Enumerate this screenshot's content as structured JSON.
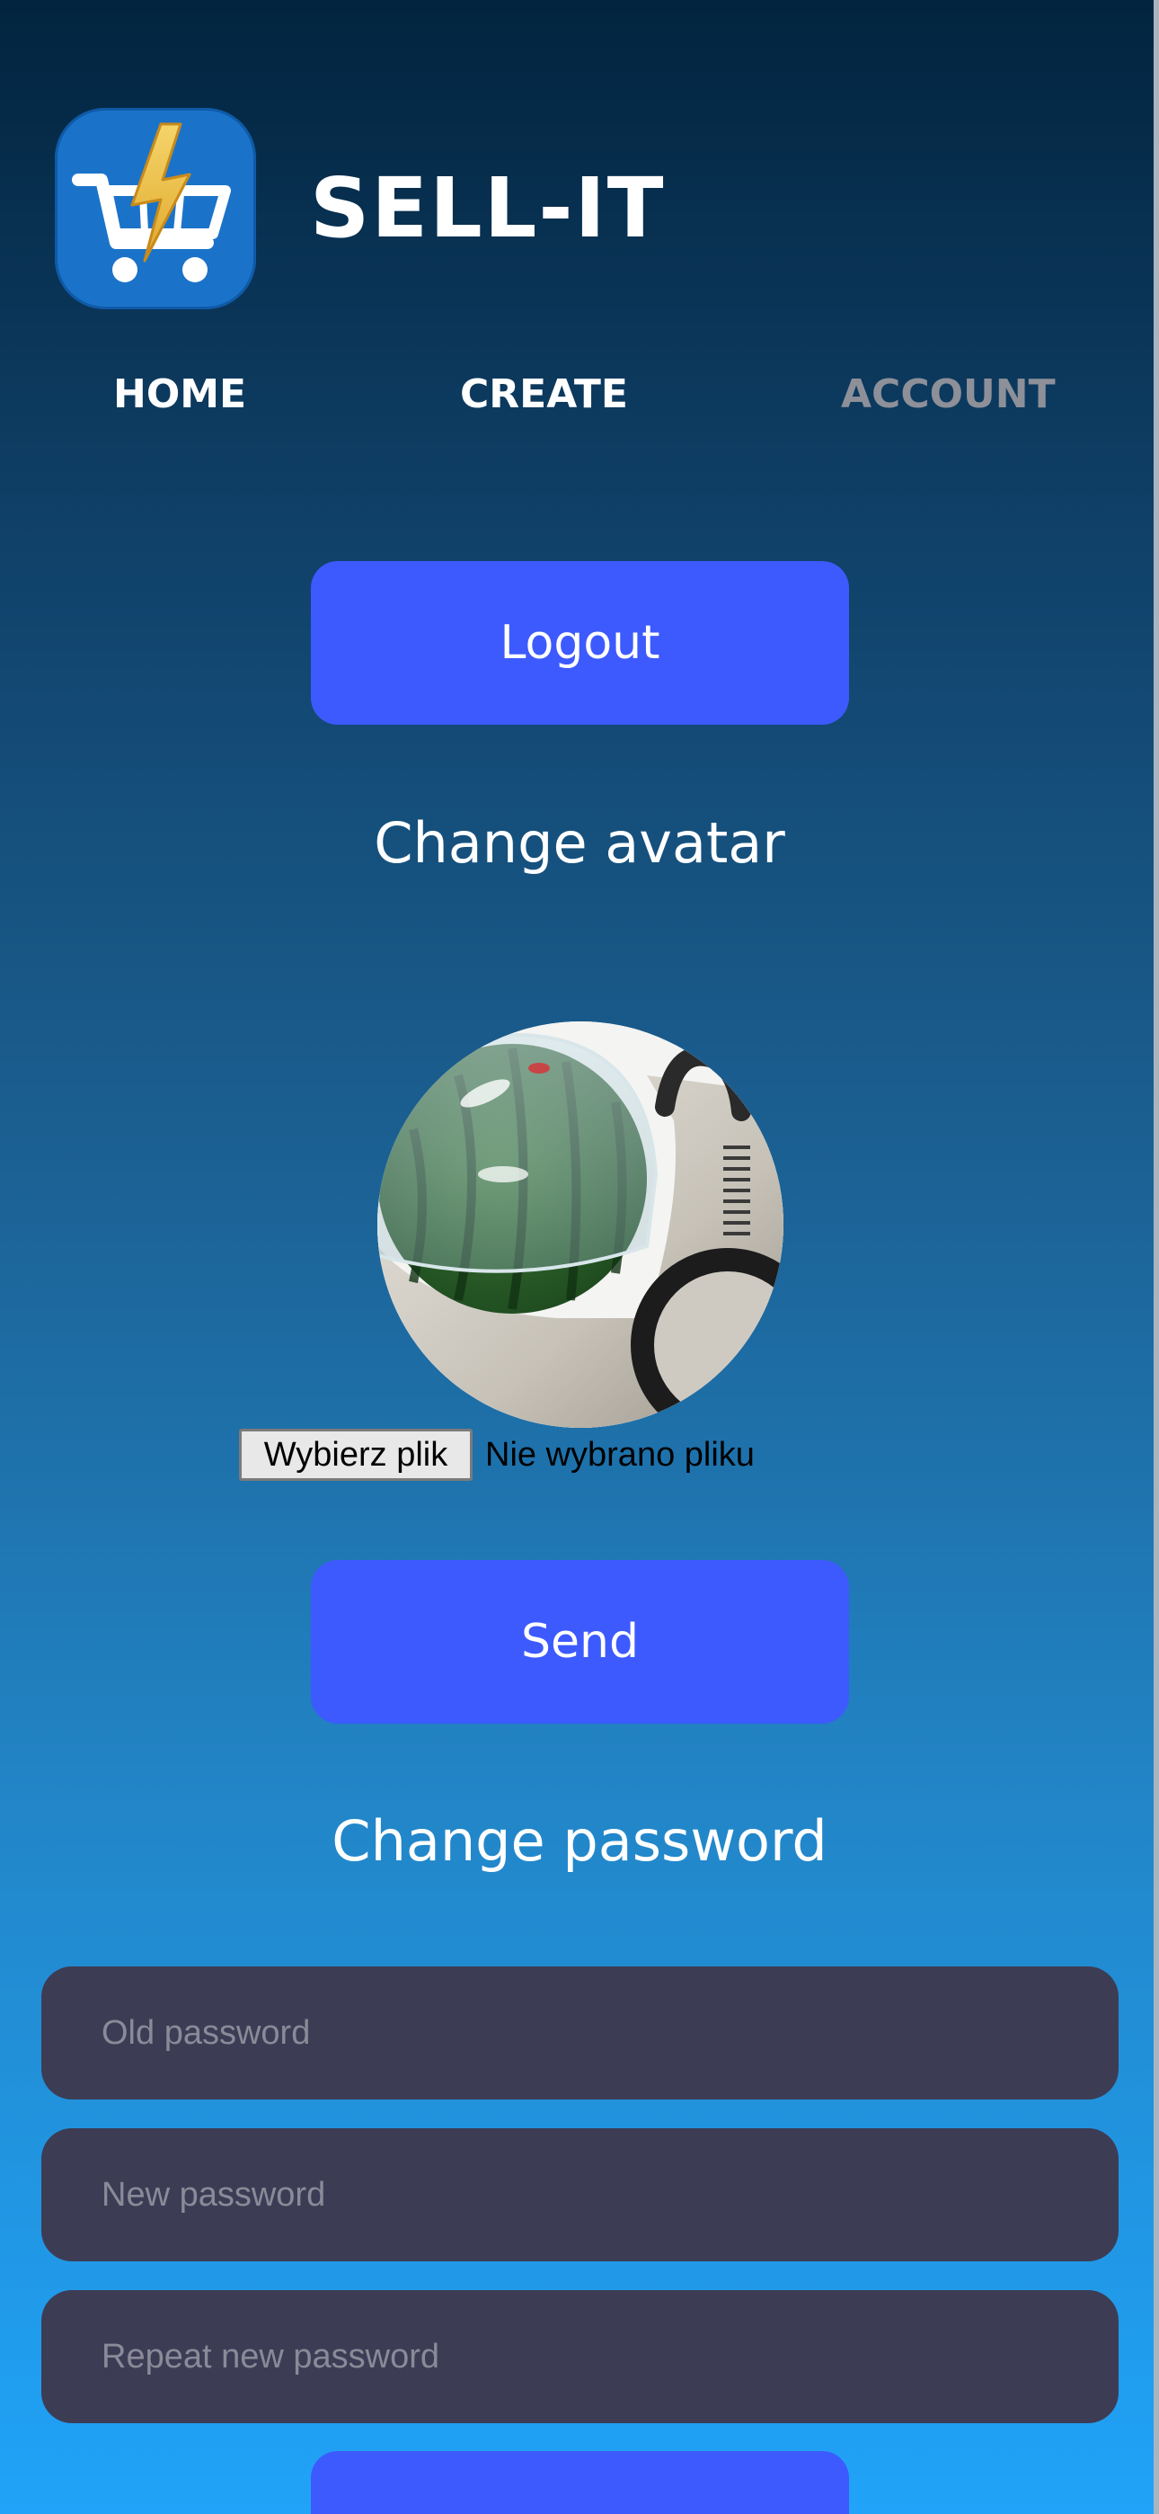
{
  "header": {
    "brand": "SELL-IT",
    "logo_icon": "lightning-cart-icon"
  },
  "nav": {
    "items": [
      {
        "label": "HOME",
        "active": false
      },
      {
        "label": "CREATE",
        "active": false
      },
      {
        "label": "ACCOUNT",
        "active": true
      }
    ]
  },
  "account": {
    "logout_label": "Logout",
    "avatar_section": {
      "title": "Change avatar",
      "file_button_label": "Wybierz plik",
      "file_status": "Nie wybrano pliku",
      "send_label": "Send"
    },
    "password_section": {
      "title": "Change password",
      "old_password_placeholder": "Old password",
      "new_password_placeholder": "New password",
      "repeat_password_placeholder": "Repeat new password"
    }
  },
  "colors": {
    "button": "#3d5afe",
    "field": "#3d3c55",
    "nav_active": "#8d9099"
  }
}
